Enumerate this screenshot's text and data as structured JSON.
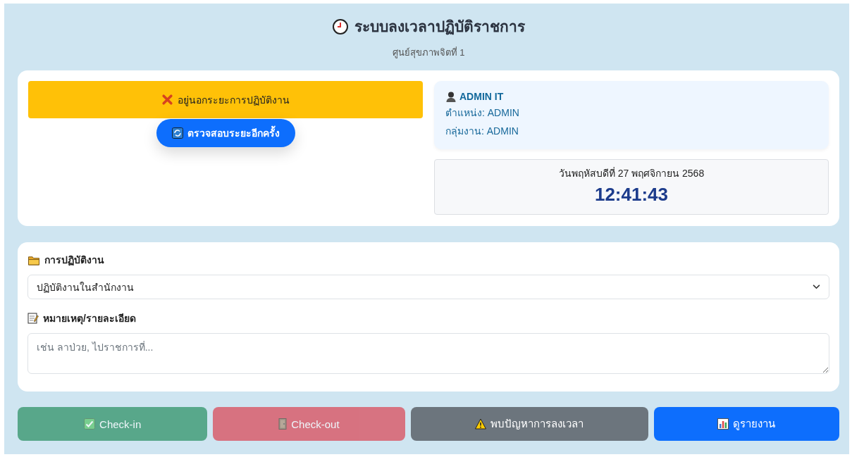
{
  "header": {
    "title": "ระบบลงเวลาปฏิบัติราชการ",
    "subtitle": "ศูนย์สุขภาพจิตที่ 1"
  },
  "status": {
    "kind": "warning",
    "text": "อยู่นอกระยะการปฏิบัติงาน"
  },
  "recheck_button": {
    "label": "ตรวจสอบระยะอีกครั้ง"
  },
  "user": {
    "name": "ADMIN IT",
    "position": "ตำแหน่ง: ADMIN",
    "group": "กลุ่มงาน: ADMIN"
  },
  "clock": {
    "date": "วันพฤหัสบดีที่ 27 พฤศจิกายน 2568",
    "time": "12:41:43"
  },
  "work_type": {
    "label": "การปฏิบัติงาน",
    "value": "ปฏิบัติงานในสำนักงาน"
  },
  "note": {
    "label": "หมายเหตุ/รายละเอียด",
    "placeholder": "เช่น ลาป่วย, ไปราชการที่..."
  },
  "actions": [
    {
      "kind": "check-in",
      "label": "Check-in",
      "disabled": true
    },
    {
      "kind": "check-out",
      "label": "Check-out",
      "disabled": true
    },
    {
      "kind": "problem",
      "label": "พบปัญหาการลงเวลา",
      "disabled": false
    },
    {
      "kind": "report",
      "label": "ดูรายงาน",
      "disabled": false
    }
  ]
}
